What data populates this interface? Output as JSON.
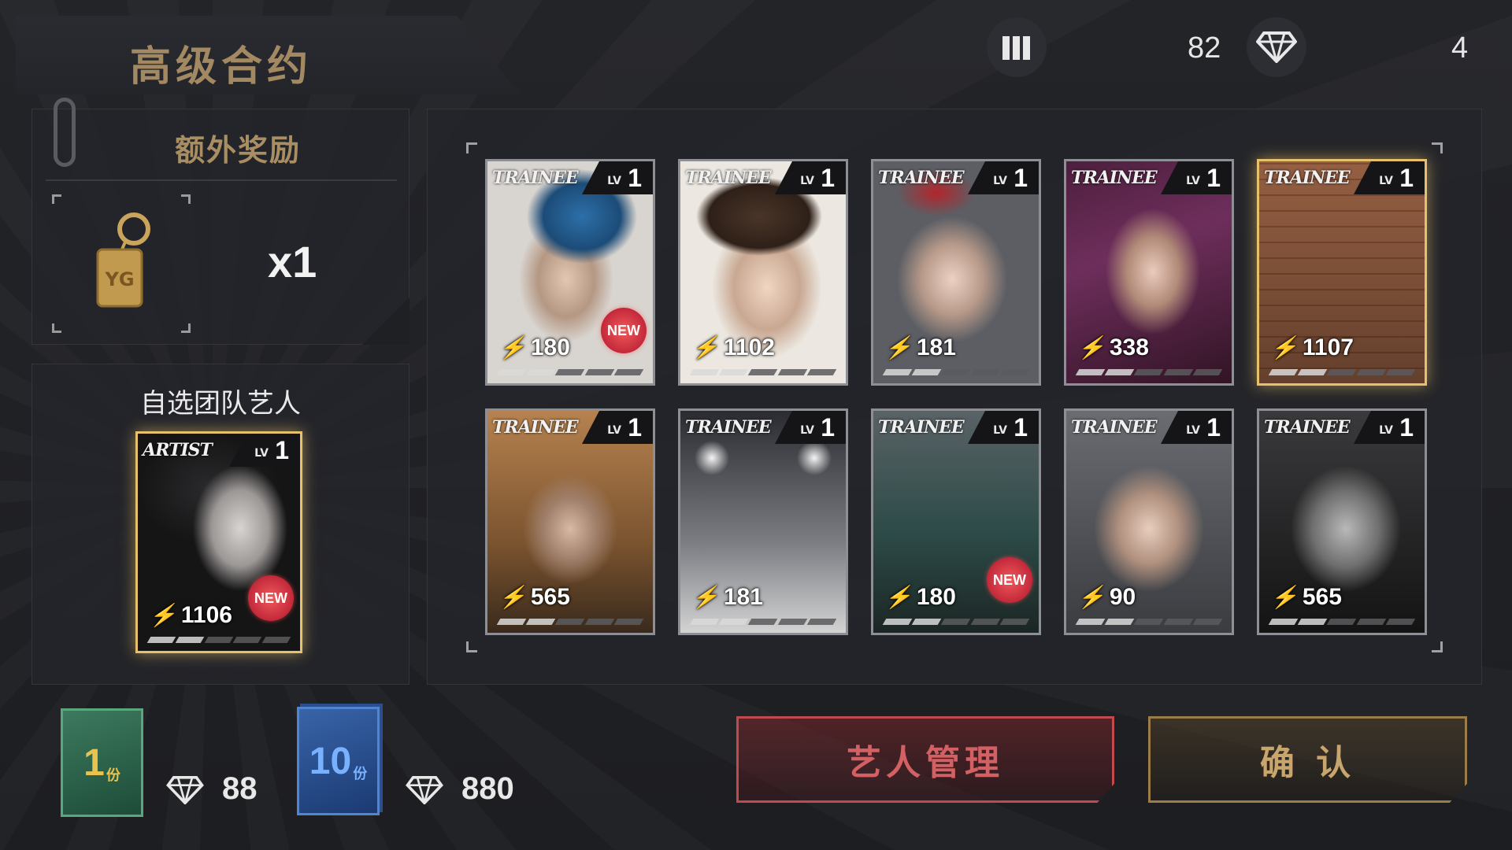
{
  "header": {
    "title": "高级合约",
    "stat_value": "82",
    "diamond_value": "4"
  },
  "bonus": {
    "title": "额外奖励",
    "item_icon": "keychain-icon",
    "quantity": "x1"
  },
  "artist_pick": {
    "label": "自选团队艺人",
    "card": {
      "label": "ARTIST",
      "lv_label": "LV",
      "level": "1",
      "power": "1106",
      "badge": "NEW"
    }
  },
  "cards": [
    {
      "label": "TRAINEE",
      "lv_label": "LV",
      "level": "1",
      "power": "180",
      "badge": "NEW"
    },
    {
      "label": "TRAINEE",
      "lv_label": "LV",
      "level": "1",
      "power": "1102",
      "badge": ""
    },
    {
      "label": "TRAINEE",
      "lv_label": "LV",
      "level": "1",
      "power": "181",
      "badge": ""
    },
    {
      "label": "TRAINEE",
      "lv_label": "LV",
      "level": "1",
      "power": "338",
      "badge": ""
    },
    {
      "label": "TRAINEE",
      "lv_label": "LV",
      "level": "1",
      "power": "1107",
      "badge": ""
    },
    {
      "label": "TRAINEE",
      "lv_label": "LV",
      "level": "1",
      "power": "565",
      "badge": ""
    },
    {
      "label": "TRAINEE",
      "lv_label": "LV",
      "level": "1",
      "power": "181",
      "badge": ""
    },
    {
      "label": "TRAINEE",
      "lv_label": "LV",
      "level": "1",
      "power": "180",
      "badge": "NEW"
    },
    {
      "label": "TRAINEE",
      "lv_label": "LV",
      "level": "1",
      "power": "90",
      "badge": ""
    },
    {
      "label": "TRAINEE",
      "lv_label": "LV",
      "level": "1",
      "power": "565",
      "badge": ""
    }
  ],
  "purchase": {
    "single": {
      "count": "1",
      "unit": "份",
      "cost": "88"
    },
    "multi": {
      "count": "10",
      "unit": "份",
      "cost": "880"
    }
  },
  "buttons": {
    "manage": "艺人管理",
    "confirm": "确 认"
  },
  "colors": {
    "gold": "#b99a62",
    "red_button": "#c04b4f",
    "green_pack": "#3d7a5e",
    "blue_pack": "#3864a8"
  }
}
